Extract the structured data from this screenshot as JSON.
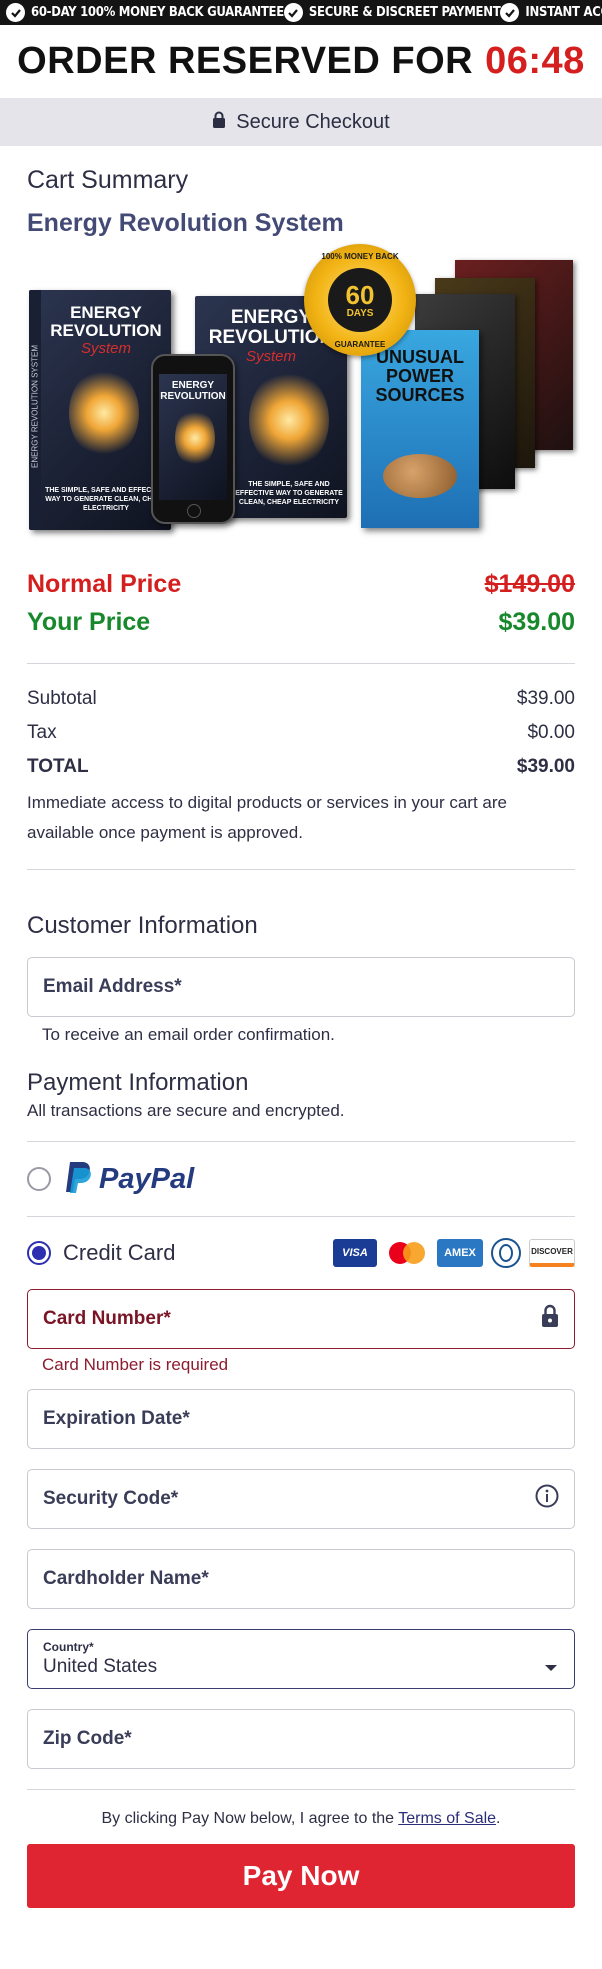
{
  "topbar": {
    "items": [
      "60-DAY 100% MONEY BACK GUARANTEE",
      "SECURE & DISCREET PAYMENT",
      "INSTANT ACCESS"
    ]
  },
  "timer": {
    "label": "ORDER RESERVED FOR",
    "time": "06:48"
  },
  "secure_bar": {
    "label": "Secure Checkout",
    "icon": "lock-icon"
  },
  "cart": {
    "heading": "Cart Summary",
    "product_name": "Energy Revolution System",
    "images": {
      "ebook_title": "ENERGY REVOLUTION",
      "ebook_script": "System",
      "ebook_spine": "ENERGY REVOLUTION SYSTEM",
      "ebook_tagline": "THE SIMPLE, SAFE AND EFFECTIVE WAY TO GENERATE CLEAN, CHEAP ELECTRICITY",
      "badge_top": "100% MONEY BACK",
      "badge_num": "60",
      "badge_days": "DAYS",
      "badge_bottom": "GUARANTEE",
      "bonus_title": "UNUSUAL POWER SOURCES"
    },
    "normal_price_label": "Normal Price",
    "normal_price": "$149.00",
    "your_price_label": "Your Price",
    "your_price": "$39.00",
    "subtotal_label": "Subtotal",
    "subtotal": "$39.00",
    "tax_label": "Tax",
    "tax": "$0.00",
    "total_label": "TOTAL",
    "total": "$39.00",
    "note": "Immediate access to digital products or services in your cart are available once payment is approved."
  },
  "customer": {
    "heading": "Customer Information",
    "email_placeholder": "Email Address*",
    "email_hint": "To receive an email order confirmation."
  },
  "payment": {
    "heading": "Payment Information",
    "subheading": "All transactions are secure and encrypted.",
    "paypal_label": "PayPal",
    "credit_card_label": "Credit Card",
    "card_logos": [
      "VISA",
      "Mastercard",
      "AMEX",
      "Diners",
      "DISCOVER"
    ],
    "card_number_placeholder": "Card Number*",
    "card_number_error": "Card Number is required",
    "expiration_placeholder": "Expiration Date*",
    "security_code_placeholder": "Security Code*",
    "cardholder_placeholder": "Cardholder Name*",
    "country_label": "Country*",
    "country_value": "United States",
    "zip_placeholder": "Zip Code*"
  },
  "footer": {
    "agree_prefix": "By clicking Pay Now below, I agree to the ",
    "terms_link": "Terms of Sale",
    "agree_suffix": ".",
    "pay_button": "Pay Now"
  },
  "colors": {
    "accent_red": "#d51e1e",
    "price_green": "#17892c",
    "pay_button": "#e02532",
    "radio_selected": "#2e2fb0"
  }
}
